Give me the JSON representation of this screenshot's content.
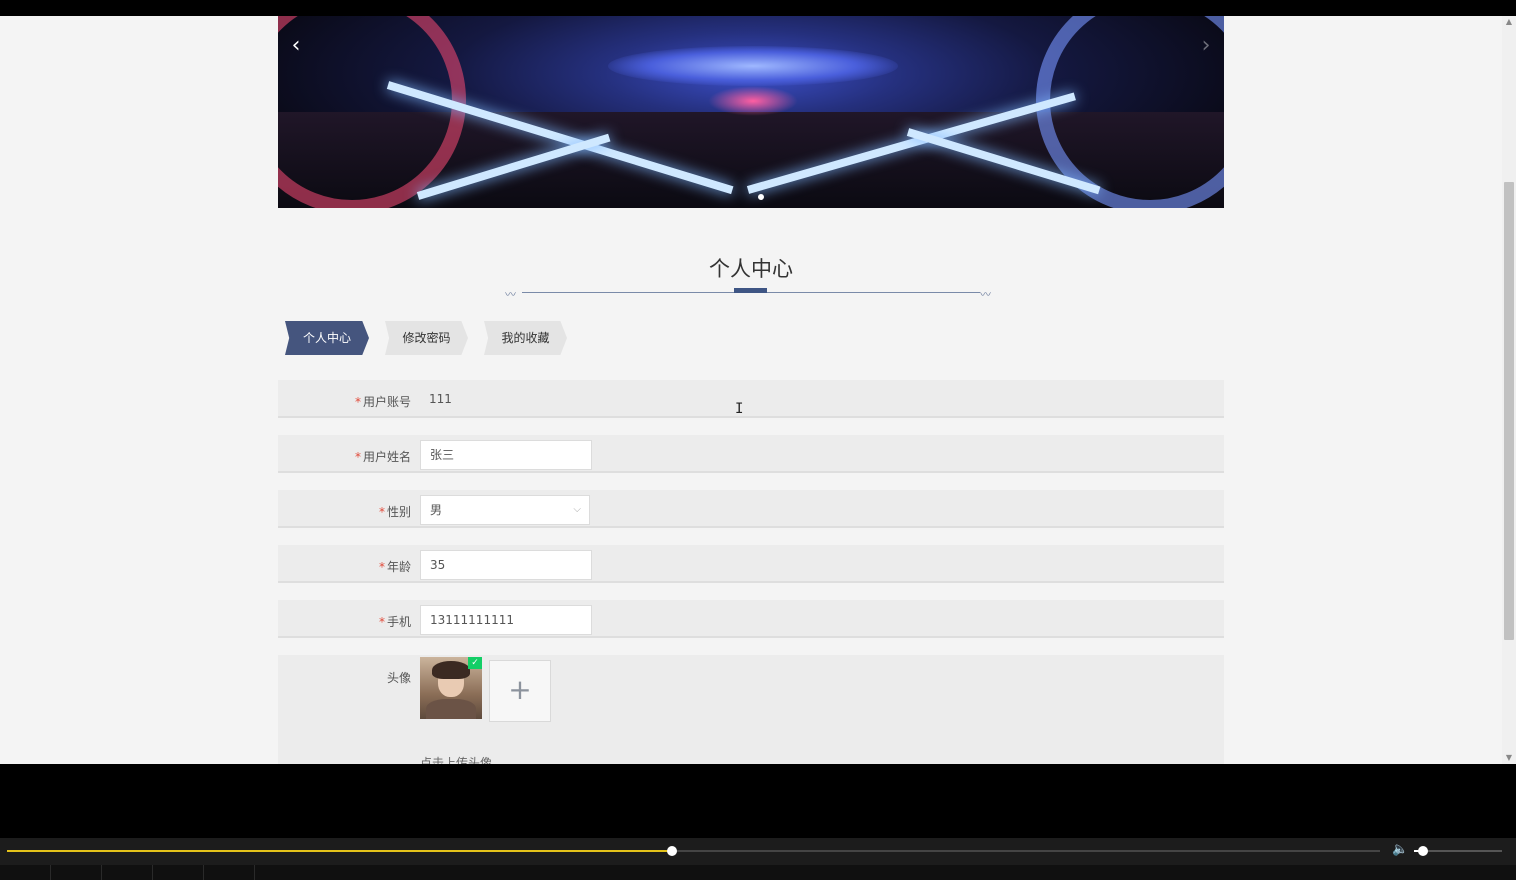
{
  "banner": {
    "prev": "‹",
    "next": "›"
  },
  "page": {
    "title": "个人中心"
  },
  "tabs": [
    {
      "label": "个人中心",
      "active": true
    },
    {
      "label": "修改密码",
      "active": false
    },
    {
      "label": "我的收藏",
      "active": false
    }
  ],
  "form": {
    "required_mark": "*",
    "account": {
      "label": "用户账号",
      "value": "111"
    },
    "name": {
      "label": "用户姓名",
      "value": "张三"
    },
    "gender": {
      "label": "性别",
      "value": "男"
    },
    "age": {
      "label": "年龄",
      "value": "35"
    },
    "phone": {
      "label": "手机",
      "value": "13111111111"
    },
    "avatar": {
      "label": "头像",
      "upload_plus": "+",
      "hint": "点击上传头像",
      "uploaded_check": "✓"
    }
  },
  "player": {
    "progress": 0.484,
    "volume": 0.1,
    "volume_icon": "🔈"
  },
  "colors": {
    "accent": "#45557e",
    "required": "#e04a3a",
    "progress": "#e3c21a"
  }
}
